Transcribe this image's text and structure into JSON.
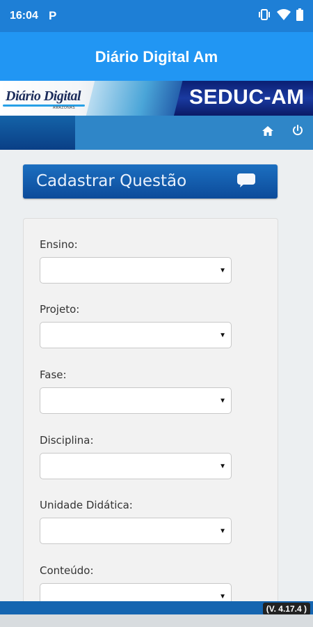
{
  "status_bar": {
    "time": "16:04",
    "notification": "P",
    "icons": [
      "vibrate-icon",
      "wifi-icon",
      "battery-icon"
    ]
  },
  "app_bar": {
    "title": "Diário Digital Am"
  },
  "banner": {
    "logo_text": "Diário Digital",
    "logo_subtext": "AMAZONAS",
    "right_text": "SEDUC-AM"
  },
  "nav": {
    "icons": [
      "home-icon",
      "power-icon"
    ]
  },
  "section": {
    "title": "Cadastrar Questão",
    "icon": "chat-bubble-icon"
  },
  "form": {
    "fields": [
      {
        "label": "Ensino:",
        "value": ""
      },
      {
        "label": "Projeto:",
        "value": ""
      },
      {
        "label": "Fase:",
        "value": ""
      },
      {
        "label": "Disciplina:",
        "value": ""
      },
      {
        "label": "Unidade Didática:",
        "value": ""
      },
      {
        "label": "Conteúdo:",
        "value": ""
      }
    ],
    "arrow": "▼"
  },
  "footer": {
    "version": "(V. 4.17.4 )"
  },
  "colors": {
    "status_bar": "#1e7fd6",
    "app_bar": "#2196f3",
    "nav_strip": "#2f86c8",
    "section_header": "#0c4b9a",
    "banner_dark": "#0b1f72"
  }
}
